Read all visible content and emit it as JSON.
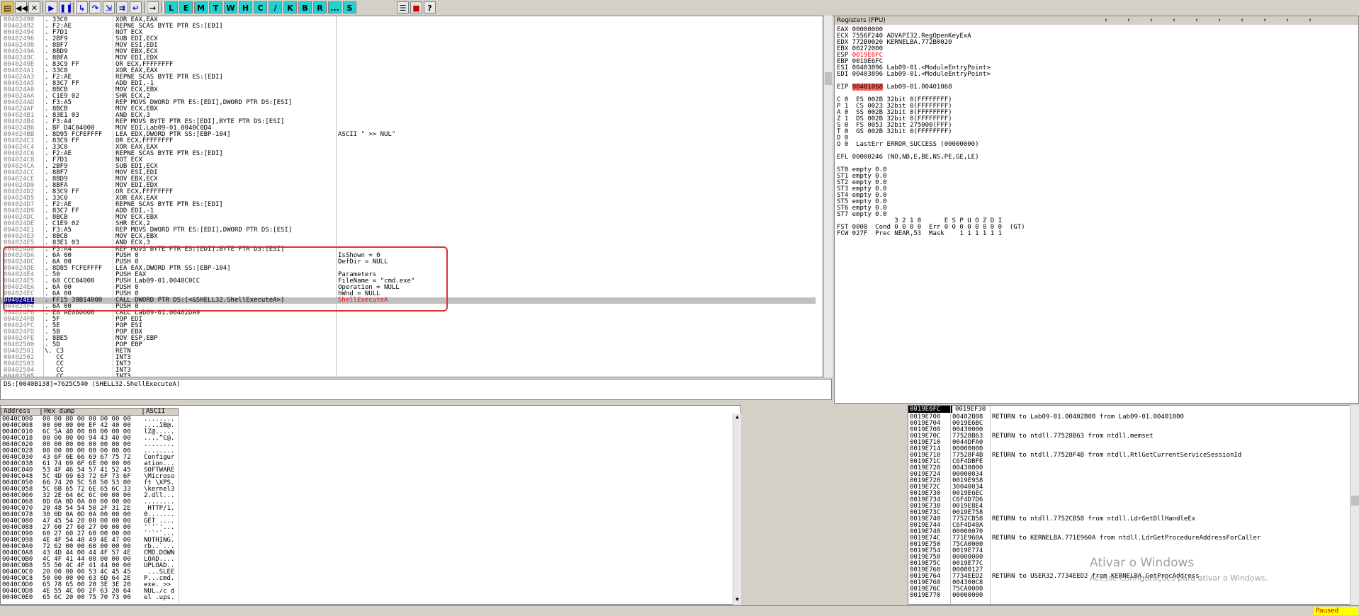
{
  "toolbar": {
    "buttons": [
      "open",
      "rewind",
      "close",
      "run",
      "pause",
      "step-into",
      "step-over",
      "trace-into",
      "trace-over",
      "execute-till-return",
      "go-to"
    ],
    "letters": [
      "L",
      "E",
      "M",
      "T",
      "W",
      "H",
      "C",
      "/",
      "K",
      "B",
      "R",
      "...",
      "S"
    ]
  },
  "disasm": {
    "rows": [
      [
        "00402490",
        ". 33C0",
        "XOR EAX,EAX",
        ""
      ],
      [
        "00402492",
        ". F2:AE",
        "REPNE SCAS BYTE PTR ES:[EDI]",
        ""
      ],
      [
        "00402494",
        ". F7D1",
        "NOT ECX",
        ""
      ],
      [
        "00402496",
        ". 2BF9",
        "SUB EDI,ECX",
        ""
      ],
      [
        "00402498",
        ". 8BF7",
        "MOV ESI,EDI",
        ""
      ],
      [
        "0040249A",
        ". 8BD9",
        "MOV EBX,ECX",
        ""
      ],
      [
        "0040249C",
        ". 8BFA",
        "MOV EDI,EDX",
        ""
      ],
      [
        "0040249E",
        ". 83C9 FF",
        "OR ECX,FFFFFFFF",
        ""
      ],
      [
        "004024A1",
        ". 33C0",
        "XOR EAX,EAX",
        ""
      ],
      [
        "004024A3",
        ". F2:AE",
        "REPNE SCAS BYTE PTR ES:[EDI]",
        ""
      ],
      [
        "004024A5",
        ". 83C7 FF",
        "ADD EDI,-1",
        ""
      ],
      [
        "004024A8",
        ". 8BCB",
        "MOV ECX,EBX",
        ""
      ],
      [
        "004024AA",
        ". C1E9 02",
        "SHR ECX,2",
        ""
      ],
      [
        "004024AD",
        ". F3:A5",
        "REP MOVS DWORD PTR ES:[EDI],DWORD PTR DS:[ESI]",
        ""
      ],
      [
        "004024AF",
        ". 8BCB",
        "MOV ECX,EBX",
        ""
      ],
      [
        "004024B1",
        ". 83E1 03",
        "AND ECX,3",
        ""
      ],
      [
        "004024B4",
        ". F3:A4",
        "REP MOVS BYTE PTR ES:[EDI],BYTE PTR DS:[ESI]",
        ""
      ],
      [
        "004024B6",
        ". BF D4C04000",
        "MOV EDI,Lab09-01.0040C0D4",
        ""
      ],
      [
        "004024BB",
        ". 8D95 FCFEFFFF",
        "LEA EDX,DWORD PTR SS:[EBP-104]",
        "ASCII \" >> NUL\""
      ],
      [
        "004024C1",
        ". 83C9 FF",
        "OR ECX,FFFFFFFF",
        ""
      ],
      [
        "004024C4",
        ". 33C0",
        "XOR EAX,EAX",
        ""
      ],
      [
        "004024C6",
        ". F2:AE",
        "REPNE SCAS BYTE PTR ES:[EDI]",
        ""
      ],
      [
        "004024C8",
        ". F7D1",
        "NOT ECX",
        ""
      ],
      [
        "004024CA",
        ". 2BF9",
        "SUB EDI,ECX",
        ""
      ],
      [
        "004024CC",
        ". 8BF7",
        "MOV ESI,EDI",
        ""
      ],
      [
        "004024CE",
        ". 8BD9",
        "MOV EBX,ECX",
        ""
      ],
      [
        "004024D0",
        ". 8BFA",
        "MOV EDI,EDX",
        ""
      ],
      [
        "004024D2",
        ". 83C9 FF",
        "OR ECX,FFFFFFFF",
        ""
      ],
      [
        "004024D5",
        ". 33C0",
        "XOR EAX,EAX",
        ""
      ],
      [
        "004024D7",
        ". F2:AE",
        "REPNE SCAS BYTE PTR ES:[EDI]",
        ""
      ],
      [
        "004024D9",
        ". 83C7 FF",
        "ADD EDI,-1",
        ""
      ],
      [
        "004024DC",
        ". 8BCB",
        "MOV ECX,EBX",
        ""
      ],
      [
        "004024DE",
        ". C1E9 02",
        "SHR ECX,2",
        ""
      ],
      [
        "004024E1",
        ". F3:A5",
        "REP MOVS DWORD PTR ES:[EDI],DWORD PTR DS:[ESI]",
        ""
      ],
      [
        "004024E3",
        ". 8BCB",
        "MOV ECX,EBX",
        ""
      ],
      [
        "004024E5",
        ". 83E1 03",
        "AND ECX,3",
        ""
      ],
      [
        "004024D8",
        ". F3:A4",
        "REP MOVS BYTE PTR ES:[EDI],BYTE PTR DS:[ESI]",
        ""
      ],
      [
        "004024DA",
        ". 6A 00",
        "PUSH 0",
        "IsShown = 0"
      ],
      [
        "004024DC",
        ". 6A 00",
        "PUSH 0",
        "DefDir = NULL"
      ],
      [
        "004024DE",
        ". 8D85 FCFEFFFF",
        "LEA EAX,DWORD PTR SS:[EBP-104]",
        ""
      ],
      [
        "004024E4",
        ". 50",
        "PUSH EAX",
        "Parameters"
      ],
      [
        "004024E5",
        ". 68 CCC04000",
        "PUSH Lab09-01.0040C0CC",
        "FileName = \"cmd.exe\""
      ],
      [
        "004024EA",
        ". 6A 00",
        "PUSH 0",
        "Operation = NULL"
      ],
      [
        "004024EC",
        ". 6A 00",
        "PUSH 0",
        "hWnd = NULL"
      ],
      [
        "004024EE",
        ". FF15 38B14000",
        "CALL DWORD PTR DS:[<&SHELL32.ShellExecuteA>]",
        "ShellExecuteA"
      ],
      [
        "004024F4",
        ". 6A 00",
        "PUSH 0",
        ""
      ],
      [
        "004024F6",
        ". E8 AE080000",
        "CALL Lab09-01.00402DA9",
        ""
      ],
      [
        "004024FB",
        ". 5F",
        "POP EDI",
        ""
      ],
      [
        "004024FC",
        ". 5E",
        "POP ESI",
        ""
      ],
      [
        "004024FD",
        ". 5B",
        "POP EBX",
        ""
      ],
      [
        "004024FE",
        ". 8BE5",
        "MOV ESP,EBP",
        ""
      ],
      [
        "00402500",
        ". 5D",
        "POP EBP",
        ""
      ],
      [
        "00402501",
        "\\. C3",
        "RETN",
        ""
      ],
      [
        "00402502",
        "   CC",
        "INT3",
        ""
      ],
      [
        "00402503",
        "   CC",
        "INT3",
        ""
      ],
      [
        "00402504",
        "   CC",
        "INT3",
        ""
      ],
      [
        "00402505",
        "   CC",
        "INT3",
        ""
      ]
    ],
    "info": "DS:[0040B138]=7625C540 (SHELL32.ShellExecuteA)"
  },
  "registers": {
    "title": "Registers (FPU)",
    "lines": [
      "EAX 00000000",
      "ECX 7556F240 ADVAPI32.RegOpenKeyExA",
      "EDX 772B0020 KERNELBA.772B0020",
      "EBX 00272000",
      "ESP 0019E6FC",
      "EBP 0019E6FC",
      "ESI 00403896 Lab09-01.<ModuleEntryPoint>",
      "EDI 00403896 Lab09-01.<ModuleEntryPoint>",
      "",
      "EIP 00401068 Lab09-01.00401068",
      "",
      "C 0  ES 002B 32bit 0(FFFFFFFF)",
      "P 1  CS 0023 32bit 0(FFFFFFFF)",
      "A 0  SS 002B 32bit 0(FFFFFFFF)",
      "Z 1  DS 002B 32bit 0(FFFFFFFF)",
      "S 0  FS 0053 32bit 275000(FFF)",
      "T 0  GS 002B 32bit 0(FFFFFFFF)",
      "D 0",
      "O 0  LastErr ERROR_SUCCESS (00000000)",
      "",
      "EFL 00000246 (NO,NB,E,BE,NS,PE,GE,LE)",
      "",
      "ST0 empty 0.0",
      "ST1 empty 0.0",
      "ST2 empty 0.0",
      "ST3 empty 0.0",
      "ST4 empty 0.0",
      "ST5 empty 0.0",
      "ST6 empty 0.0",
      "ST7 empty 0.0",
      "               3 2 1 0      E S P U O Z D I",
      "FST 0000  Cond 0 0 0 0  Err 0 0 0 0 0 0 0 0  (GT)",
      "FCW 027F  Prec NEAR,53  Mask    1 1 1 1 1 1"
    ]
  },
  "dump": {
    "headers": [
      "Address",
      "Hex dump",
      "ASCII"
    ],
    "rows": [
      [
        "0040C000",
        "00 00 00 00 00 00 00 00",
        "........"
      ],
      [
        "0040C008",
        "00 00 00 00 EF 42 40 00",
        "....ïB@."
      ],
      [
        "0040C010",
        "6C 5A 40 00 00 00 00 00",
        "lZ@....."
      ],
      [
        "0040C018",
        "00 00 00 00 94 43 40 00",
        "....”C@."
      ],
      [
        "0040C020",
        "00 00 00 00 00 00 00 00",
        "........"
      ],
      [
        "0040C028",
        "00 00 00 00 00 00 00 00",
        "........"
      ],
      [
        "0040C030",
        "43 6F 6E 66 69 67 75 72",
        "Configur"
      ],
      [
        "0040C038",
        "61 74 69 6F 6E 00 00 00",
        "ation..."
      ],
      [
        "0040C040",
        "53 4F 46 54 57 41 52 45",
        "SOFTWARE"
      ],
      [
        "0040C048",
        "5C 4D 69 63 72 6F 73 6F",
        "\\Microso"
      ],
      [
        "0040C050",
        "66 74 20 5C 58 50 53 00",
        "ft \\XPS."
      ],
      [
        "0040C058",
        "5C 6B 65 72 6E 65 6C 33",
        "\\kernel3"
      ],
      [
        "0040C060",
        "32 2E 64 6C 6C 00 00 00",
        "2.dll..."
      ],
      [
        "0040C068",
        "0D 0A 0D 0A 00 00 00 00",
        "........"
      ],
      [
        "0040C070",
        "20 48 54 54 50 2F 31 2E",
        " HTTP/1."
      ],
      [
        "0040C078",
        "30 0D 0A 0D 0A 00 00 00",
        "0......."
      ],
      [
        "0040C080",
        "47 45 54 20 00 00 00 00",
        "GET ...."
      ],
      [
        "0040C088",
        "27 60 27 60 27 00 00 00",
        "'`'`'..."
      ],
      [
        "0040C090",
        "60 27 60 27 60 00 00 00",
        "`'`'`..."
      ],
      [
        "0040C098",
        "4E 4F 54 48 49 4E 47 00",
        "NOTHING."
      ],
      [
        "0040C0A0",
        "72 62 00 00 60 00 00 00",
        "rb..`..."
      ],
      [
        "0040C0A8",
        "43 4D 44 00 44 4F 57 4E",
        "CMD.DOWN"
      ],
      [
        "0040C0B0",
        "4C 4F 41 44 00 00 00 00",
        "LOAD...."
      ],
      [
        "0040C0B8",
        "55 50 4C 4F 41 44 00 00",
        "UPLOAD.."
      ],
      [
        "0040C0C0",
        "20 00 00 00 53 4C 45 45",
        " ...SLEE"
      ],
      [
        "0040C0C8",
        "50 00 00 00 63 6D 64 2E",
        "P...cmd."
      ],
      [
        "0040C0D0",
        "65 78 65 00 20 3E 3E 20",
        "exe. >> "
      ],
      [
        "0040C0D8",
        "4E 55 4C 00 2F 63 20 64",
        "NUL./c d"
      ],
      [
        "0040C0E0",
        "65 6C 20 00 75 70 73 00",
        "el .ups."
      ]
    ]
  },
  "stack": {
    "header_left": "0019E6FC",
    "header_right": "0019EF30",
    "rows": [
      [
        "0019E700",
        "00402B08",
        "RETURN to Lab09-01.00402B08 from Lab09-01.00401000"
      ],
      [
        "0019E704",
        "0019E6BC",
        ""
      ],
      [
        "0019E708",
        "00430000",
        ""
      ],
      [
        "0019E70C",
        "77528B63",
        "RETURN to ntdll.77528B63 from ntdll.memset"
      ],
      [
        "0019E710",
        "0044DFA0",
        ""
      ],
      [
        "0019E714",
        "00000000",
        ""
      ],
      [
        "0019E718",
        "77528F4B",
        "RETURN to ntdll.77528F4B from ntdll.RtlGetCurrentServiceSessionId"
      ],
      [
        "0019E71C",
        "C6F4DBFE",
        ""
      ],
      [
        "0019E720",
        "00430000",
        ""
      ],
      [
        "0019E724",
        "00000034",
        ""
      ],
      [
        "0019E728",
        "0019E958",
        ""
      ],
      [
        "0019E72C",
        "30040034",
        ""
      ],
      [
        "0019E730",
        "0019E6EC",
        ""
      ],
      [
        "0019E734",
        "C6F4D7D6",
        ""
      ],
      [
        "0019E738",
        "0019E8E4",
        ""
      ],
      [
        "0019E73C",
        "0019E758",
        ""
      ],
      [
        "0019E740",
        "7752CB58",
        "RETURN to ntdll.7752CB58 from ntdll.LdrGetDllHandleEx"
      ],
      [
        "0019E744",
        "C6F4D40A",
        ""
      ],
      [
        "0019E748",
        "00000070",
        ""
      ],
      [
        "0019E74C",
        "771E960A",
        "RETURN to KERNELBA.771E960A from ntdll.LdrGetProcedureAddressForCaller"
      ],
      [
        "0019E750",
        "75CA0000",
        ""
      ],
      [
        "0019E754",
        "0019E774",
        ""
      ],
      [
        "0019E758",
        "00000000",
        ""
      ],
      [
        "0019E75C",
        "0019E77C",
        ""
      ],
      [
        "0019E760",
        "00000127",
        ""
      ],
      [
        "0019E764",
        "7734EED2",
        "RETURN to USER32.7734EED2 from KERNELBA.GetProcAddress"
      ],
      [
        "0019E768",
        "004300C8",
        ""
      ],
      [
        "0019E76C",
        "75CA0000",
        ""
      ],
      [
        "0019E770",
        "00000000",
        ""
      ]
    ]
  },
  "watermark": {
    "title": "Ativar o Windows",
    "subtitle": "Acesse Configurações para ativar o Windows."
  },
  "status": {
    "state": "Paused"
  }
}
